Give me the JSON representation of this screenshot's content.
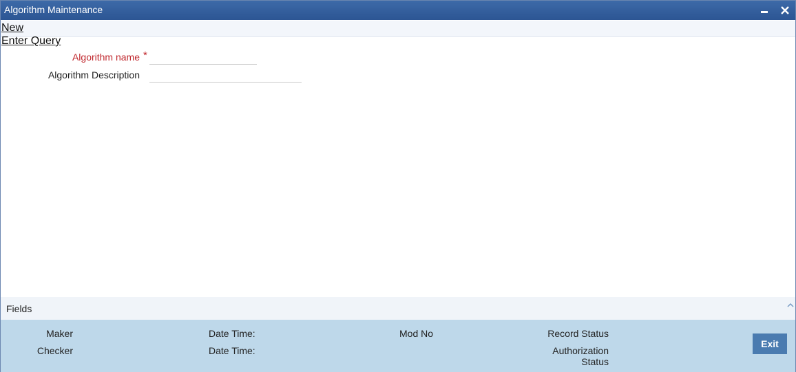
{
  "window": {
    "title": "Algorithm Maintenance"
  },
  "toolbar": {
    "new_label": "New",
    "enter_query_label": "Enter Query"
  },
  "form": {
    "algorithm_name_label": "Algorithm name",
    "required_marker": "*",
    "algorithm_name_value": "",
    "algorithm_description_label": "Algorithm Description",
    "algorithm_description_value": ""
  },
  "fields_section": {
    "label": "Fields",
    "icon": "chevron-up-icon"
  },
  "audit": {
    "maker_label": "Maker",
    "checker_label": "Checker",
    "maker_datetime_label": "Date Time:",
    "checker_datetime_label": "Date Time:",
    "mod_no_label": "Mod No",
    "record_status_label": "Record Status",
    "authorization_status_label": "Authorization Status",
    "exit_label": "Exit"
  },
  "colors": {
    "titlebar": "#2c5593",
    "required_label": "#c0272d",
    "audit_panel": "#bed8ea",
    "exit_button": "#4a7bb0"
  }
}
